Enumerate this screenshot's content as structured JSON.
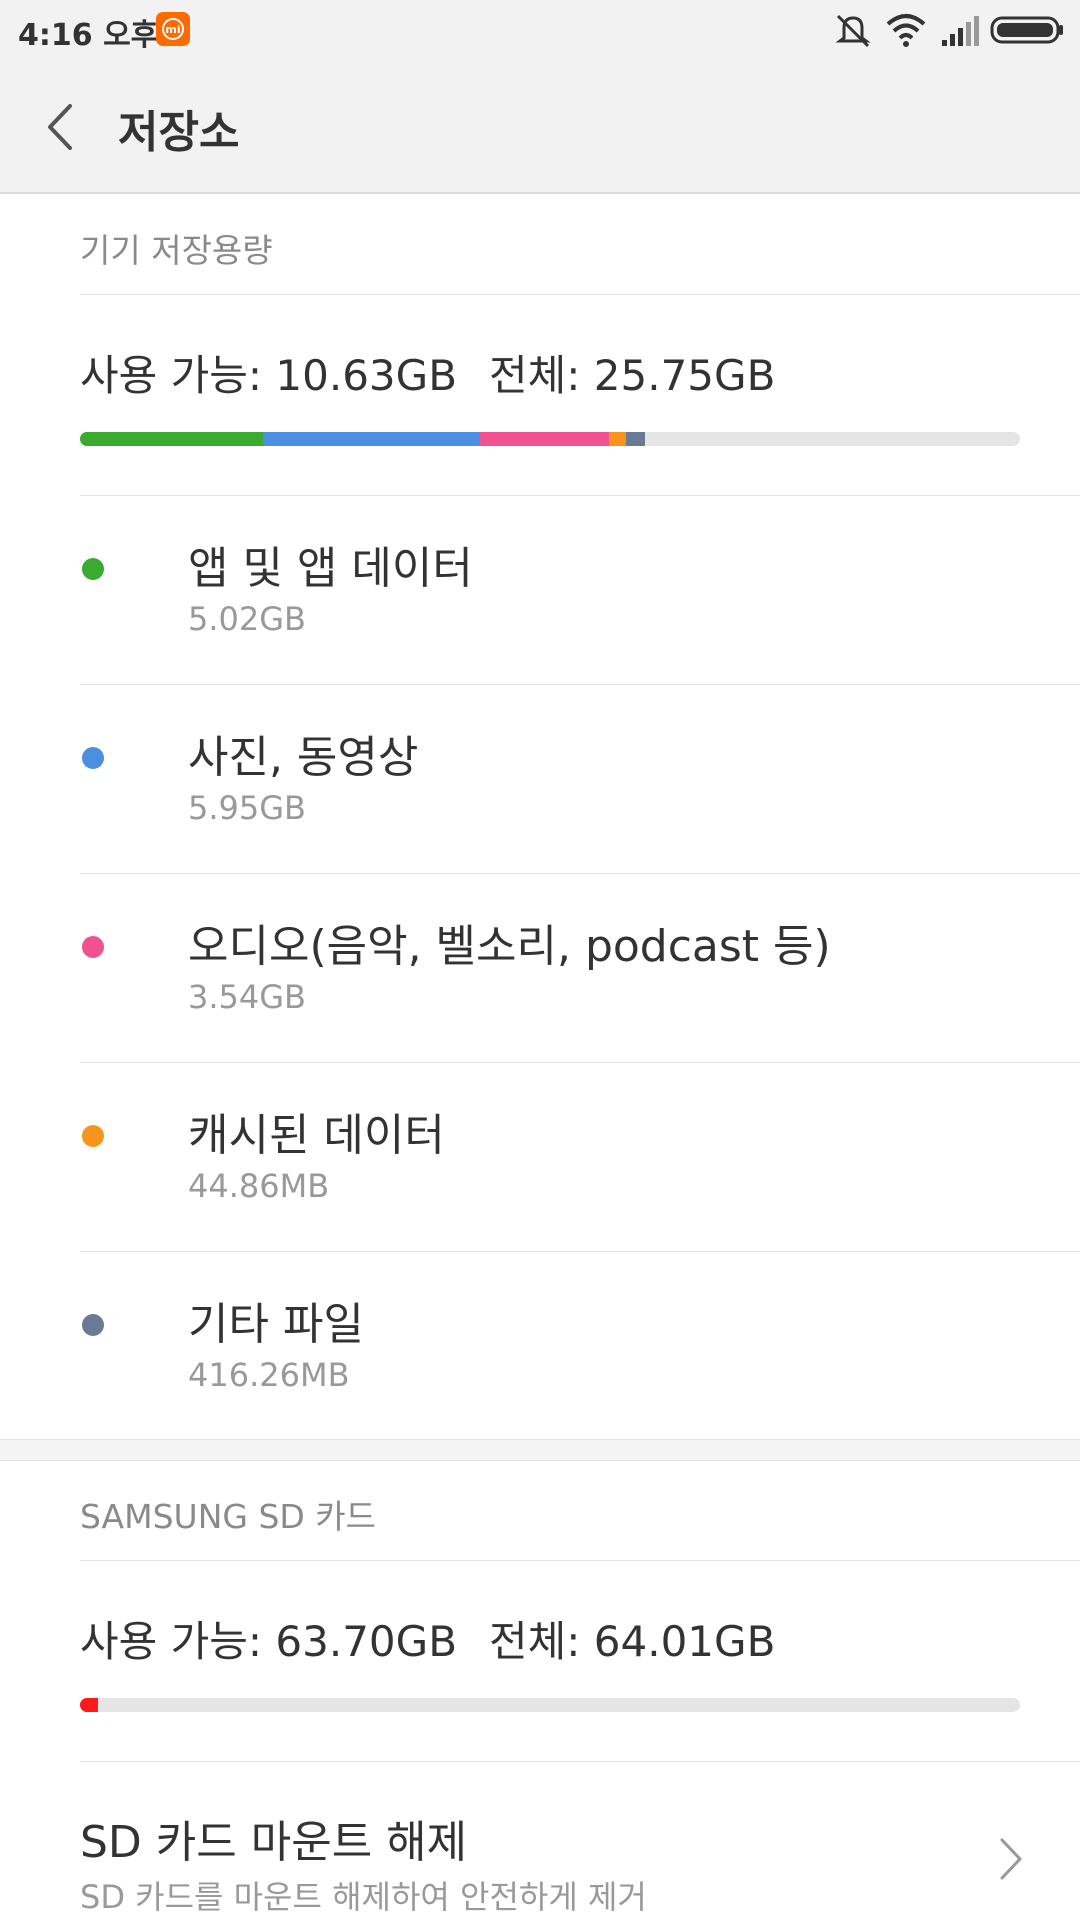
{
  "status_bar": {
    "time": "4:16 오후",
    "app_badge": "mi",
    "icons": [
      "mute-icon",
      "wifi-icon",
      "signal-icon",
      "battery-icon"
    ]
  },
  "app_bar": {
    "title": "저장소"
  },
  "device_storage": {
    "header": "기기 저장용량",
    "available_label": "사용 가능: 10.63GB",
    "total_label": "전체: 25.75GB",
    "usage_bar": [
      {
        "name": "apps",
        "color": "#3aab2e",
        "fraction": 0.195
      },
      {
        "name": "photos",
        "color": "#4a8fe0",
        "fraction": 0.231
      },
      {
        "name": "audio",
        "color": "#f0518f",
        "fraction": 0.137
      },
      {
        "name": "cache",
        "color": "#f7941d",
        "fraction": 0.018
      },
      {
        "name": "other",
        "color": "#6b7a94",
        "fraction": 0.02
      }
    ],
    "categories": [
      {
        "label": "앱 및 앱 데이터",
        "size": "5.02GB",
        "color": "#3aab2e"
      },
      {
        "label": "사진, 동영상",
        "size": "5.95GB",
        "color": "#4a8fe0"
      },
      {
        "label": "오디오(음악, 벨소리, podcast 등)",
        "size": "3.54GB",
        "color": "#f0518f"
      },
      {
        "label": "캐시된 데이터",
        "size": "44.86MB",
        "color": "#f7941d"
      },
      {
        "label": "기타 파일",
        "size": "416.26MB",
        "color": "#6b7a94"
      }
    ]
  },
  "sd_card": {
    "header": "SAMSUNG SD 카드",
    "available_label": "사용 가능: 63.70GB",
    "total_label": "전체: 64.01GB",
    "usage_bar": [
      {
        "name": "used",
        "color": "#ff1a1a",
        "fraction": 0.019
      }
    ],
    "unmount": {
      "label": "SD 카드 마운트 해제",
      "description": "SD 카드를 마운트 해제하여 안전하게 제거"
    }
  }
}
